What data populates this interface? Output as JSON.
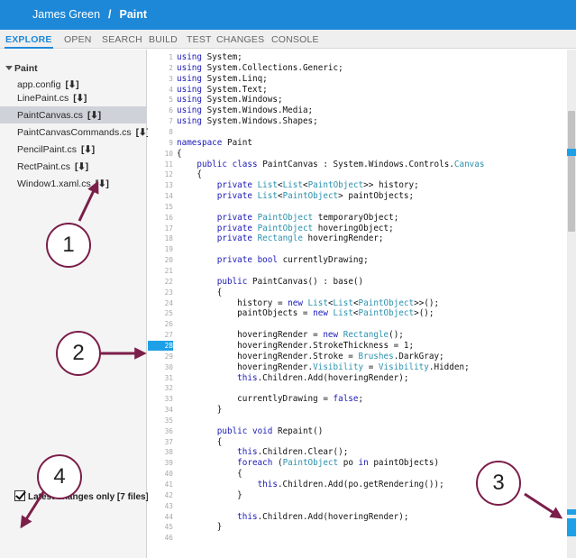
{
  "breadcrumb": {
    "user": "James Green",
    "separator": "/",
    "project": "Paint"
  },
  "tabs": [
    {
      "label": "EXPLORE",
      "active": true
    },
    {
      "label": "OPEN",
      "active": false
    },
    {
      "label": "SEARCH",
      "active": false
    },
    {
      "label": "BUILD",
      "active": false
    },
    {
      "label": "TEST",
      "active": false
    },
    {
      "label": "CHANGES",
      "active": false
    },
    {
      "label": "CONSOLE",
      "active": false
    }
  ],
  "sidebar": {
    "folder": "Paint",
    "download_glyph": "[⬇]",
    "files": [
      {
        "name": "app.config"
      },
      {
        "name": "LinePaint.cs"
      },
      {
        "name": "PaintCanvas.cs",
        "selected": true
      },
      {
        "name": "PaintCanvasCommands.cs"
      },
      {
        "name": "PencilPaint.cs"
      },
      {
        "name": "RectPaint.cs"
      },
      {
        "name": "Window1.xaml.cs"
      }
    ],
    "latest_label": "Latest changes only [7 files]",
    "latest_checked": true
  },
  "editor": {
    "highlighted_line": 28,
    "line_numbers": [
      "1",
      "2",
      "3",
      "4",
      "5",
      "6",
      "7",
      "8",
      "9",
      "10",
      "11",
      "12",
      "13",
      "14",
      "15",
      "16",
      "17",
      "18",
      "19",
      "20",
      "21",
      "22",
      "23",
      "24",
      "25",
      "26",
      "27",
      "28",
      "29",
      "30",
      "31",
      "32",
      "33",
      "34",
      "35",
      "36",
      "37",
      "38",
      "39",
      "40",
      "41",
      "42",
      "43",
      "44",
      "45",
      "46"
    ],
    "code": [
      "using System;",
      "using System.Collections.Generic;",
      "using System.Linq;",
      "using System.Text;",
      "using System.Windows;",
      "using System.Windows.Media;",
      "using System.Windows.Shapes;",
      "",
      "namespace Paint",
      "{",
      "    public class PaintCanvas : System.Windows.Controls.Canvas",
      "    {",
      "        private List<List<PaintObject>> history;",
      "        private List<PaintObject> paintObjects;",
      "",
      "        private PaintObject temporaryObject;",
      "        private PaintObject hoveringObject;",
      "        private Rectangle hoveringRender;",
      "",
      "        private bool currentlyDrawing;",
      "",
      "        public PaintCanvas() : base()",
      "        {",
      "            history = new List<List<PaintObject>>();",
      "            paintObjects = new List<PaintObject>();",
      "",
      "            hoveringRender = new Rectangle();",
      "            hoveringRender.StrokeThickness = 1;",
      "            hoveringRender.Stroke = Brushes.DarkGray;",
      "            hoveringRender.Visibility = Visibility.Hidden;",
      "            this.Children.Add(hoveringRender);",
      "",
      "            currentlyDrawing = false;",
      "        }",
      "",
      "        public void Repaint()",
      "        {",
      "            this.Children.Clear();",
      "            foreach (PaintObject po in paintObjects)",
      "            {",
      "                this.Children.Add(po.getRendering());",
      "            }",
      "",
      "            this.Children.Add(hoveringRender);",
      "        }",
      ""
    ]
  },
  "callouts": [
    "1",
    "2",
    "3",
    "4"
  ],
  "colors": {
    "accent": "#1e88d8",
    "marker": "#1ea0e6",
    "callout_arrow": "#7b1e4a"
  }
}
